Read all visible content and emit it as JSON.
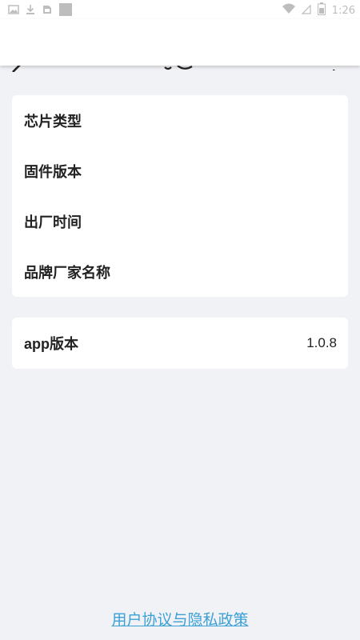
{
  "status_bar": {
    "time": "1:26",
    "icons": [
      "gallery-icon",
      "download-icon",
      "sim-icon",
      "notification-square-icon",
      "wifi-icon",
      "no-sim-icon",
      "battery-icon"
    ]
  },
  "device_info": {
    "items": [
      {
        "label": "芯片类型",
        "value": ""
      },
      {
        "label": "固件版本",
        "value": ""
      },
      {
        "label": "出厂时间",
        "value": ""
      },
      {
        "label": "品牌厂家名称",
        "value": ""
      }
    ]
  },
  "app_info": {
    "label": "app版本",
    "value": "1.0.8"
  },
  "footer": {
    "link_text": "用户协议与隐私政策"
  },
  "colors": {
    "background": "#f1f2f6",
    "card": "#ffffff",
    "text": "#222222",
    "link": "#3ba0d6"
  }
}
